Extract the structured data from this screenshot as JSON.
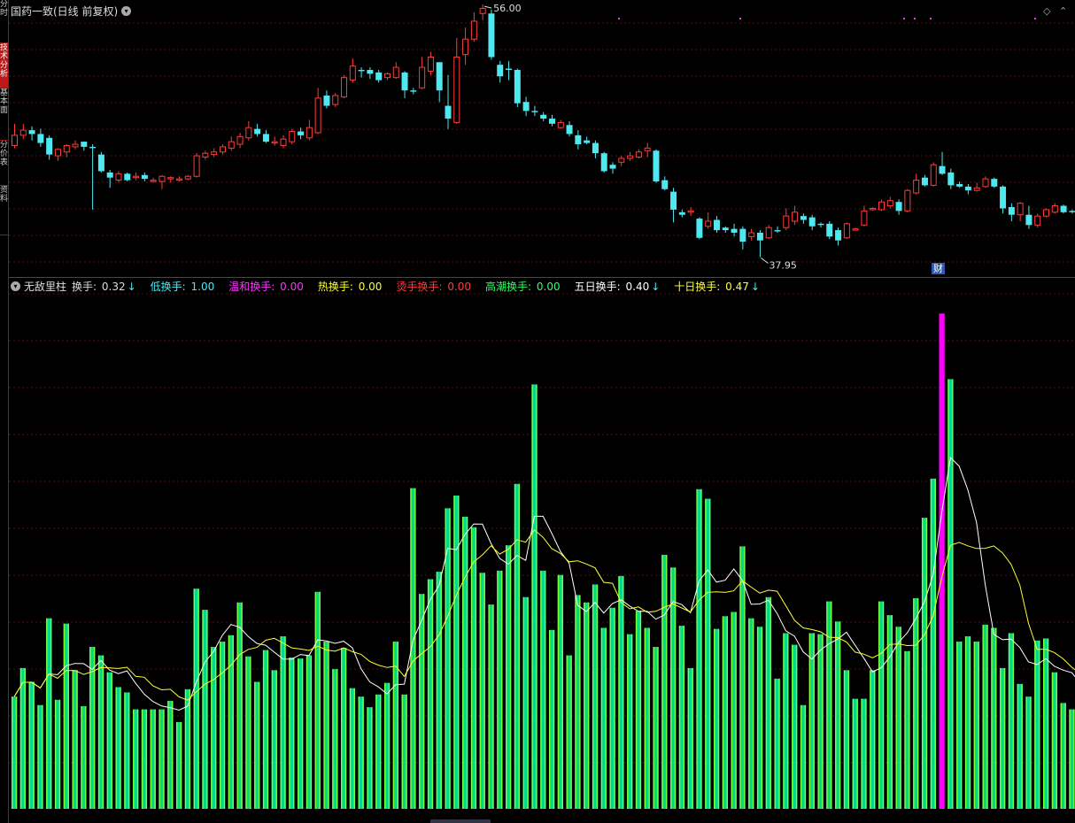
{
  "sidebar": {
    "tabs": [
      {
        "label": "分时",
        "active": false
      },
      {
        "label": "技术分析",
        "active": true
      },
      {
        "label": "基本面",
        "active": false
      },
      {
        "label": "分价表",
        "active": false
      },
      {
        "label": "资料",
        "active": false
      }
    ]
  },
  "main_chart": {
    "title": "国药一致(日线 前复权)",
    "high_label": "56.00",
    "low_label": "37.95",
    "finance_badge": "财",
    "colors": {
      "up": "#ff3b3b",
      "down": "#4fe8f0",
      "grid": "#5a0f0f"
    }
  },
  "indicator": {
    "name": "无敌里柱",
    "items": [
      {
        "label": "换手:",
        "value": "0.32",
        "color": "#dddddd",
        "arrow": "↓",
        "arrow_color": "#4fe8f0"
      },
      {
        "label": "低换手:",
        "value": "1.00",
        "color": "#4fe8f0",
        "arrow": "",
        "arrow_color": ""
      },
      {
        "label": "温和换手:",
        "value": "0.00",
        "color": "#ff33ff",
        "arrow": "",
        "arrow_color": ""
      },
      {
        "label": "热换手:",
        "value": "0.00",
        "color": "#ffff33",
        "arrow": "",
        "arrow_color": ""
      },
      {
        "label": "烫手换手:",
        "value": "0.00",
        "color": "#ff3b3b",
        "arrow": "",
        "arrow_color": ""
      },
      {
        "label": "高潮换手:",
        "value": "0.00",
        "color": "#33ff66",
        "arrow": "",
        "arrow_color": ""
      },
      {
        "label": "五日换手:",
        "value": "0.40",
        "color": "#ffffff",
        "arrow": "↓",
        "arrow_color": "#4fe8f0"
      },
      {
        "label": "十日换手:",
        "value": "0.47",
        "color": "#ffff33",
        "arrow": "↓",
        "arrow_color": "#4fe8f0"
      }
    ]
  },
  "chart_data": [
    {
      "type": "candlestick",
      "title": "国药一致(日线 前复权)",
      "annotations": {
        "high": 56.0,
        "low": 37.95
      },
      "ylim": [
        37.0,
        57.5
      ],
      "candles": [
        [
          46.7,
          47.5,
          48.4,
          46.5
        ],
        [
          47.5,
          47.9,
          48.4,
          47.2
        ],
        [
          47.9,
          47.6,
          48.2,
          47.1
        ],
        [
          47.6,
          46.9,
          48.0,
          46.6
        ],
        [
          47.3,
          46.0,
          47.5,
          45.6
        ],
        [
          45.9,
          46.4,
          46.5,
          45.5
        ],
        [
          46.2,
          46.7,
          46.8,
          45.8
        ],
        [
          46.6,
          46.8,
          47.1,
          46.4
        ],
        [
          47.0,
          46.6,
          47.0,
          46.3
        ],
        [
          46.6,
          46.5,
          46.8,
          41.7
        ],
        [
          46.0,
          44.7,
          46.2,
          44.6
        ],
        [
          44.6,
          44.2,
          44.8,
          43.4
        ],
        [
          44.0,
          44.5,
          44.7,
          43.8
        ],
        [
          44.5,
          44.0,
          44.6,
          43.9
        ],
        [
          44.2,
          44.3,
          44.6,
          44.0
        ],
        [
          44.4,
          44.1,
          44.6,
          43.9
        ],
        [
          43.9,
          44.0,
          44.2,
          43.8
        ],
        [
          43.9,
          44.3,
          44.4,
          43.3
        ],
        [
          44.1,
          44.2,
          44.3,
          43.8
        ],
        [
          44.0,
          44.1,
          44.3,
          43.9
        ],
        [
          44.1,
          44.3,
          44.4,
          44.0
        ],
        [
          44.3,
          45.9,
          46.1,
          44.2
        ],
        [
          45.8,
          46.1,
          46.3,
          45.6
        ],
        [
          46.0,
          46.2,
          46.5,
          45.8
        ],
        [
          46.2,
          46.6,
          46.8,
          46.0
        ],
        [
          46.5,
          47.0,
          47.4,
          46.3
        ],
        [
          46.8,
          47.4,
          47.7,
          46.5
        ],
        [
          47.3,
          48.1,
          48.6,
          47.1
        ],
        [
          48.0,
          47.6,
          48.4,
          47.4
        ],
        [
          47.6,
          47.0,
          47.9,
          46.9
        ],
        [
          46.9,
          47.0,
          47.4,
          46.7
        ],
        [
          46.7,
          47.2,
          47.5,
          46.5
        ],
        [
          47.0,
          47.8,
          48.0,
          46.8
        ],
        [
          47.8,
          47.5,
          48.1,
          47.2
        ],
        [
          47.3,
          48.1,
          48.7,
          47.1
        ],
        [
          47.7,
          50.4,
          51.2,
          47.6
        ],
        [
          50.6,
          49.8,
          51.0,
          49.6
        ],
        [
          49.9,
          50.6,
          50.8,
          49.7
        ],
        [
          50.5,
          52.0,
          52.2,
          50.4
        ],
        [
          51.8,
          52.9,
          53.5,
          51.6
        ],
        [
          52.6,
          52.5,
          52.8,
          52.0
        ],
        [
          52.6,
          52.3,
          52.8,
          51.9
        ],
        [
          52.4,
          51.8,
          52.6,
          51.6
        ],
        [
          52.0,
          52.3,
          52.4,
          51.8
        ],
        [
          52.0,
          52.8,
          53.2,
          51.9
        ],
        [
          52.4,
          51.0,
          52.5,
          50.4
        ],
        [
          51.0,
          50.9,
          51.2,
          50.7
        ],
        [
          51.2,
          52.8,
          53.6,
          51.1
        ],
        [
          52.5,
          53.6,
          54.0,
          52.2
        ],
        [
          53.2,
          51.0,
          53.2,
          50.1
        ],
        [
          49.8,
          48.8,
          52.2,
          48.0
        ],
        [
          48.5,
          53.6,
          55.1,
          48.4
        ],
        [
          53.8,
          55.0,
          55.9,
          53.0
        ],
        [
          55.0,
          56.4,
          57.1,
          54.8
        ],
        [
          57.0,
          57.4,
          57.7,
          56.5
        ],
        [
          57.0,
          53.6,
          57.3,
          53.4
        ],
        [
          53.0,
          52.1,
          53.3,
          51.6
        ],
        [
          52.7,
          52.6,
          53.3,
          51.8
        ],
        [
          52.6,
          50.0,
          52.7,
          49.7
        ],
        [
          50.1,
          49.4,
          50.5,
          49.0
        ],
        [
          49.4,
          49.3,
          49.8,
          49.0
        ],
        [
          49.1,
          48.8,
          49.3,
          48.6
        ],
        [
          48.8,
          48.4,
          49.1,
          48.2
        ],
        [
          48.1,
          48.5,
          48.7,
          48.0
        ],
        [
          48.3,
          47.6,
          48.6,
          47.4
        ],
        [
          47.5,
          46.8,
          47.9,
          46.4
        ],
        [
          47.1,
          46.9,
          47.4,
          46.8
        ],
        [
          46.9,
          46.1,
          47.1,
          45.7
        ],
        [
          46.1,
          44.7,
          46.2,
          44.6
        ],
        [
          45.2,
          44.9,
          45.4,
          44.5
        ],
        [
          45.4,
          45.7,
          45.9,
          45.1
        ],
        [
          45.7,
          45.9,
          46.2,
          45.5
        ],
        [
          45.8,
          46.2,
          46.4,
          45.7
        ],
        [
          46.3,
          46.5,
          46.9,
          45.8
        ],
        [
          46.3,
          43.9,
          46.4,
          43.8
        ],
        [
          44.0,
          43.3,
          44.3,
          43.2
        ],
        [
          43.1,
          41.7,
          43.4,
          40.7
        ],
        [
          41.5,
          41.3,
          41.7,
          41.1
        ],
        [
          41.5,
          41.6,
          41.9,
          41.2
        ],
        [
          41.0,
          39.5,
          41.1,
          39.4
        ],
        [
          40.4,
          40.8,
          41.5,
          40.2
        ],
        [
          40.9,
          40.1,
          41.2,
          39.9
        ],
        [
          40.3,
          40.1,
          40.4,
          39.9
        ],
        [
          40.2,
          39.9,
          40.6,
          39.6
        ],
        [
          40.2,
          39.2,
          40.4,
          38.6
        ],
        [
          39.6,
          39.9,
          40.2,
          39.3
        ],
        [
          39.9,
          39.3,
          40.1,
          38.0
        ],
        [
          39.5,
          40.3,
          40.5,
          39.4
        ],
        [
          40.1,
          40.0,
          40.4,
          39.9
        ],
        [
          40.3,
          41.2,
          41.8,
          40.1
        ],
        [
          40.8,
          41.5,
          42.0,
          40.5
        ],
        [
          41.2,
          40.9,
          41.4,
          40.6
        ],
        [
          41.1,
          40.4,
          41.3,
          40.1
        ],
        [
          40.6,
          40.5,
          40.7,
          40.3
        ],
        [
          40.6,
          39.6,
          40.8,
          39.4
        ],
        [
          40.1,
          39.3,
          40.3,
          38.9
        ],
        [
          39.5,
          40.6,
          40.7,
          39.4
        ],
        [
          40.1,
          40.2,
          40.3,
          40.1
        ],
        [
          40.5,
          41.6,
          42.0,
          40.4
        ],
        [
          41.7,
          41.8,
          41.9,
          41.6
        ],
        [
          41.7,
          42.3,
          42.5,
          41.6
        ],
        [
          42.0,
          42.4,
          42.7,
          41.8
        ],
        [
          42.3,
          41.6,
          42.5,
          41.3
        ],
        [
          41.6,
          43.2,
          43.3,
          41.5
        ],
        [
          43.0,
          44.0,
          44.5,
          42.9
        ],
        [
          44.2,
          43.6,
          44.4,
          43.5
        ],
        [
          43.6,
          45.2,
          45.4,
          43.5
        ],
        [
          45.1,
          44.5,
          46.2,
          44.4
        ],
        [
          44.6,
          43.6,
          44.9,
          43.3
        ],
        [
          43.7,
          43.5,
          43.9,
          43.4
        ],
        [
          43.5,
          43.2,
          43.7,
          42.9
        ],
        [
          43.2,
          43.4,
          43.8,
          43.1
        ],
        [
          43.5,
          44.1,
          44.3,
          43.4
        ],
        [
          44.1,
          43.5,
          44.2,
          43.4
        ],
        [
          43.5,
          41.8,
          43.6,
          41.4
        ],
        [
          41.9,
          41.3,
          42.2,
          40.8
        ],
        [
          41.3,
          42.2,
          42.3,
          40.8
        ],
        [
          41.3,
          40.5,
          42.0,
          40.2
        ],
        [
          40.5,
          41.2,
          41.4,
          40.3
        ],
        [
          41.2,
          41.7,
          41.8,
          41.1
        ],
        [
          41.5,
          42.0,
          42.2,
          41.4
        ],
        [
          42.0,
          41.5,
          42.1,
          41.4
        ],
        [
          41.6,
          41.5,
          41.7,
          41.4
        ],
        [
          41.6,
          41.2,
          41.8,
          41.1
        ],
        [
          41.3,
          41.3,
          41.4,
          41.1
        ],
        [
          41.3,
          40.8,
          41.4,
          40.7
        ],
        [
          40.9,
          40.2,
          41.1,
          40.1
        ],
        [
          40.3,
          40.3,
          40.5,
          40.1
        ],
        [
          40.3,
          40.4,
          40.6,
          40.2
        ]
      ]
    },
    {
      "type": "bar",
      "title": "无敌里柱",
      "ylim": [
        0,
        4.9
      ],
      "turnover": [
        1.06,
        1.33,
        1.2,
        0.98,
        1.8,
        1.03,
        1.75,
        1.31,
        0.97,
        1.53,
        1.45,
        1.29,
        1.15,
        1.1,
        0.94,
        0.94,
        0.94,
        0.94,
        1.02,
        0.82,
        1.13,
        2.08,
        1.88,
        1.53,
        1.58,
        1.64,
        1.95,
        1.44,
        1.2,
        1.5,
        1.31,
        1.63,
        1.43,
        1.42,
        1.45,
        2.05,
        1.58,
        1.32,
        1.52,
        1.14,
        1.06,
        0.96,
        1.08,
        1.19,
        1.58,
        1.08,
        3.03,
        2.03,
        2.17,
        2.24,
        2.84,
        2.96,
        2.76,
        2.66,
        2.23,
        1.93,
        2.25,
        2.49,
        3.07,
        2.0,
        4.01,
        2.25,
        1.69,
        2.21,
        1.45,
        2.02,
        1.95,
        2.12,
        1.71,
        1.9,
        2.2,
        1.65,
        1.87,
        1.71,
        1.53,
        2.4,
        2.28,
        1.73,
        1.33,
        3.02,
        2.93,
        1.7,
        1.82,
        1.86,
        2.48,
        1.8,
        1.72,
        2.0,
        1.23,
        1.66,
        1.55,
        0.98,
        1.66,
        1.65,
        1.96,
        1.77,
        1.31,
        1.04,
        1.04,
        1.31,
        1.96,
        1.83,
        1.72,
        1.49,
        1.99,
        2.75,
        3.12,
        4.68,
        4.06,
        1.58,
        1.63,
        1.58,
        1.74,
        1.71,
        1.33,
        1.66,
        1.18,
        1.06,
        1.59,
        1.61,
        1.29,
        1.0,
        0.94,
        1.08,
        0.96,
        0.95,
        0.74,
        0.86,
        0.63
      ],
      "colors": {
        "default": "#00d98a",
        "edge": "#7dff3c",
        "spike": "#ff00ff"
      },
      "spike_index": 107
    }
  ]
}
